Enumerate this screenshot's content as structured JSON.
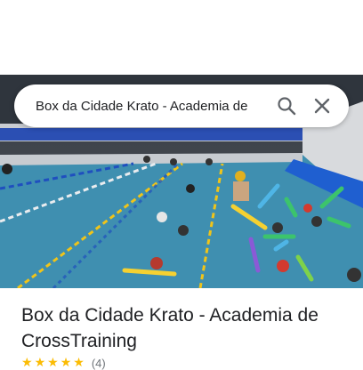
{
  "search": {
    "query": "Box da Cidade Krato - Academia de",
    "search_icon": "search-icon",
    "close_icon": "close-icon"
  },
  "photo": {
    "description_icon": "pool-photo"
  },
  "place": {
    "title": "Box da Cidade Krato - Academia de CrossTraining",
    "rating_stars": 5,
    "rating_count": "(4)"
  },
  "colors": {
    "water": "#3f8fb0",
    "lane_blue": "#1f4fbf",
    "lane_yellow": "#f0c419",
    "accent_search": "#5f6368"
  }
}
